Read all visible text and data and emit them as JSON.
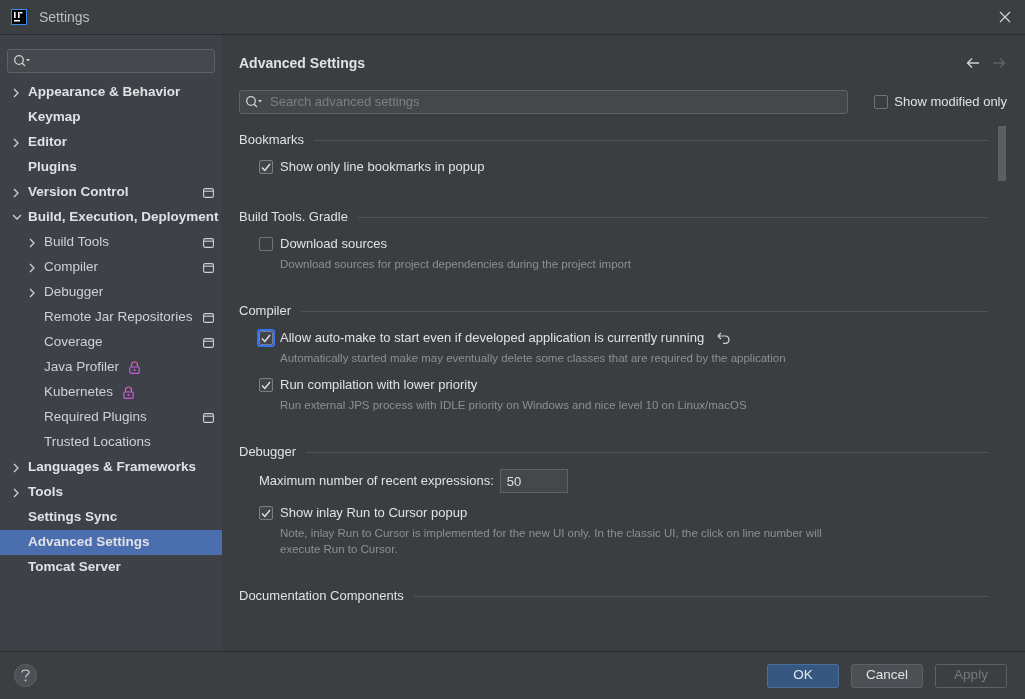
{
  "window": {
    "title": "Settings"
  },
  "sidebar": {
    "items": [
      {
        "label": "Appearance & Behavior",
        "expanded": false,
        "selected": false,
        "kind": "plain"
      },
      {
        "label": "Keymap",
        "selected": false,
        "kind": "plain"
      },
      {
        "label": "Editor",
        "expanded": false,
        "selected": false,
        "kind": "plain"
      },
      {
        "label": "Plugins",
        "selected": false,
        "kind": "plain"
      },
      {
        "label": "Version Control",
        "expanded": false,
        "selected": false,
        "kind": "project"
      },
      {
        "label": "Build, Execution, Deployment",
        "expanded": true,
        "selected": false,
        "kind": "plain",
        "children": [
          {
            "label": "Build Tools",
            "expanded": false,
            "selected": false,
            "kind": "project"
          },
          {
            "label": "Compiler",
            "expanded": false,
            "selected": false,
            "kind": "project"
          },
          {
            "label": "Debugger",
            "expanded": false,
            "selected": false,
            "kind": "plain"
          },
          {
            "label": "Remote Jar Repositories",
            "selected": false,
            "kind": "project"
          },
          {
            "label": "Coverage",
            "selected": false,
            "kind": "project"
          },
          {
            "label": "Java Profiler",
            "selected": false,
            "kind": "lock"
          },
          {
            "label": "Kubernetes",
            "selected": false,
            "kind": "lock"
          },
          {
            "label": "Required Plugins",
            "selected": false,
            "kind": "project"
          },
          {
            "label": "Trusted Locations",
            "selected": false,
            "kind": "plain"
          }
        ]
      },
      {
        "label": "Languages & Frameworks",
        "expanded": false,
        "selected": false,
        "kind": "plain"
      },
      {
        "label": "Tools",
        "expanded": false,
        "selected": false,
        "kind": "plain"
      },
      {
        "label": "Settings Sync",
        "selected": false,
        "kind": "plain"
      },
      {
        "label": "Advanced Settings",
        "selected": true,
        "kind": "plain"
      },
      {
        "label": "Tomcat Server",
        "selected": false,
        "kind": "plain"
      }
    ]
  },
  "content": {
    "title": "Advanced Settings",
    "back_enabled": true,
    "forward_enabled": false,
    "search": {
      "placeholder": "Search advanced settings"
    },
    "show_modified_only": {
      "label": "Show modified only",
      "checked": false
    },
    "sections": [
      {
        "title": "Bookmarks",
        "settings": [
          {
            "kind": "checkbox",
            "label": "Show only line bookmarks in popup",
            "checked": true,
            "focused": false,
            "modified": false
          }
        ]
      },
      {
        "title": "Build Tools. Gradle",
        "settings": [
          {
            "kind": "checkbox",
            "label": "Download sources",
            "checked": false,
            "focused": false,
            "modified": false,
            "description": "Download sources for project dependencies during the project import"
          }
        ]
      },
      {
        "title": "Compiler",
        "settings": [
          {
            "kind": "checkbox",
            "label": "Allow auto-make to start even if developed application is currently running",
            "checked": true,
            "focused": true,
            "modified": true,
            "description": "Automatically started make may eventually delete some classes that are required by the application"
          },
          {
            "kind": "checkbox",
            "label": "Run compilation with lower priority",
            "checked": true,
            "focused": false,
            "modified": false,
            "description": "Run external JPS process with IDLE priority on Windows and nice level 10 on Linux/macOS"
          }
        ]
      },
      {
        "title": "Debugger",
        "settings": [
          {
            "kind": "number",
            "label": "Maximum number of recent expressions:",
            "value": "50"
          },
          {
            "kind": "checkbox",
            "label": "Show inlay Run to Cursor popup",
            "checked": true,
            "focused": false,
            "modified": false,
            "description": "Note, inlay Run to Cursor is implemented for the new UI only. In the classic UI, the click on line number will execute Run to Cursor."
          }
        ]
      },
      {
        "title": "Documentation Components"
      }
    ]
  },
  "buttons": [
    {
      "label": "OK",
      "kind": "default",
      "disabled": false
    },
    {
      "label": "Cancel",
      "kind": "normal",
      "disabled": false
    },
    {
      "label": "Apply",
      "kind": "normal",
      "disabled": true
    }
  ]
}
